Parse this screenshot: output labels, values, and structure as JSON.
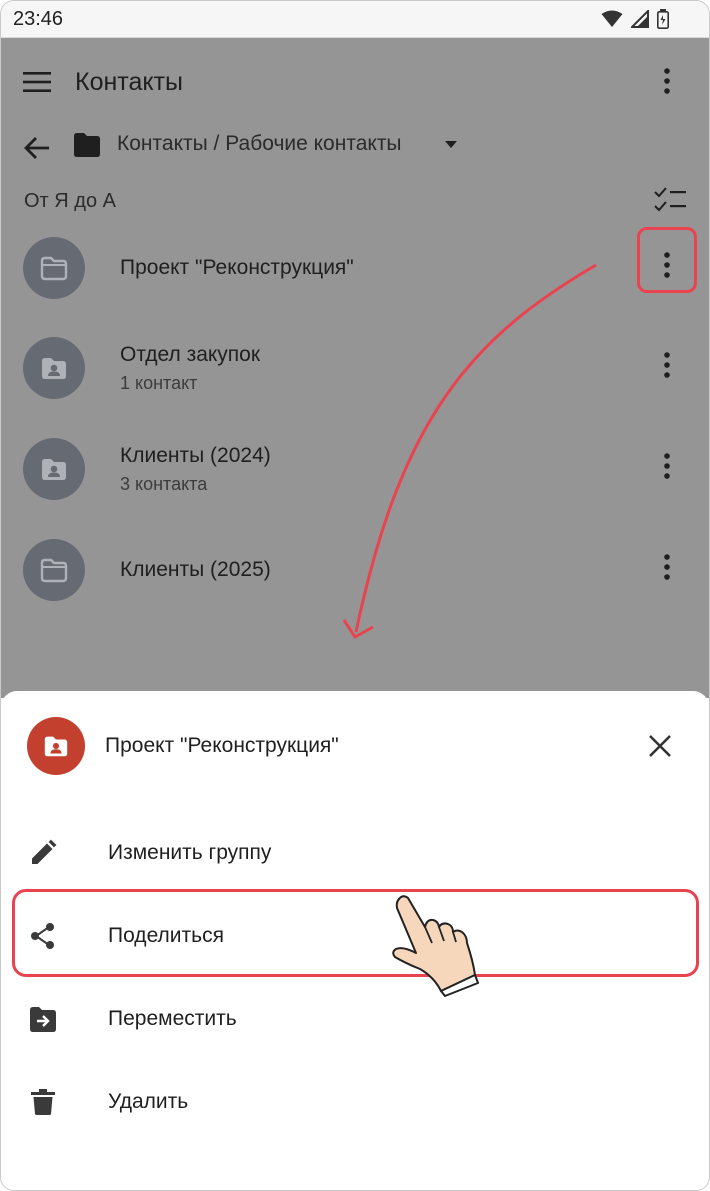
{
  "status_bar": {
    "time": "23:46",
    "icons": [
      "wifi-icon",
      "signal-icon",
      "battery-icon"
    ]
  },
  "app_bar": {
    "title": "Контакты",
    "icons": [
      "menu-icon",
      "more-vert-icon"
    ]
  },
  "breadcrumb": {
    "path": "Контакты / Рабочие контакты"
  },
  "sort": {
    "label": "От Я до А"
  },
  "groups": [
    {
      "title": "Проект \"Реконструкция\"",
      "subtitle": "",
      "icon": "folder-icon"
    },
    {
      "title": "Отдел закупок",
      "subtitle": "1 контакт",
      "icon": "contact-folder-icon"
    },
    {
      "title": "Клиенты (2024)",
      "subtitle": "3 контакта",
      "icon": "contact-folder-icon"
    },
    {
      "title": "Клиенты (2025)",
      "subtitle": "",
      "icon": "folder-icon"
    }
  ],
  "sheet": {
    "title": "Проект \"Реконструкция\"",
    "items": [
      {
        "label": "Изменить группу",
        "icon": "pencil-icon"
      },
      {
        "label": "Поделиться",
        "icon": "share-icon"
      },
      {
        "label": "Переместить",
        "icon": "move-to-folder-icon"
      },
      {
        "label": "Удалить",
        "icon": "trash-icon"
      }
    ]
  },
  "colors": {
    "overlay": "#959595",
    "avatar": "#666a73",
    "sheet_avatar": "#c33f2e",
    "highlight": "#e8434f"
  }
}
